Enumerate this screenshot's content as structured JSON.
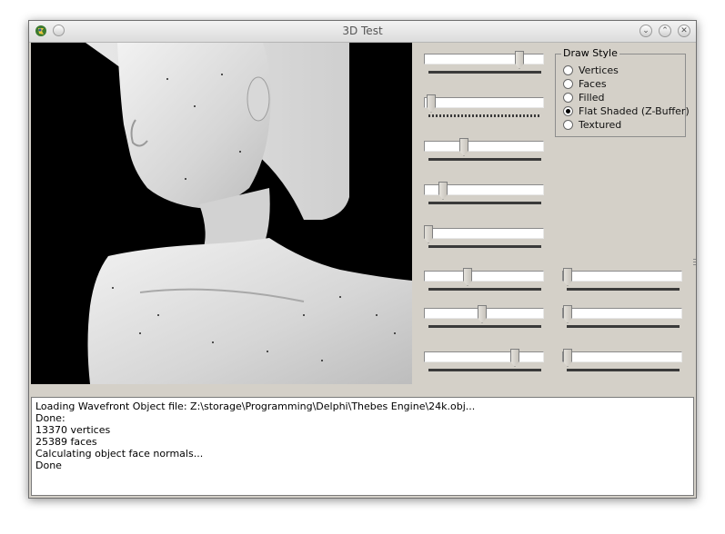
{
  "window": {
    "title": "3D Test"
  },
  "draw_style": {
    "legend": "Draw Style",
    "options": [
      {
        "label": "Vertices",
        "checked": false
      },
      {
        "label": "Faces",
        "checked": false
      },
      {
        "label": "Filled",
        "checked": false
      },
      {
        "label": "Flat Shaded (Z-Buffer)",
        "checked": true
      },
      {
        "label": "Textured",
        "checked": false
      }
    ]
  },
  "sliders": {
    "s1": {
      "value": 0.81
    },
    "s2": {
      "value": 0.03
    },
    "s3": {
      "value": 0.32
    },
    "s4": {
      "value": 0.15
    },
    "s5": {
      "value": 0.0
    },
    "s6": {
      "value": 0.37
    },
    "s7": {
      "value": 0.5
    },
    "s8": {
      "value": 0.76
    },
    "s9": {
      "value": 0.0
    },
    "s10": {
      "value": 0.0
    },
    "s11": {
      "value": 0.0
    }
  },
  "log": {
    "lines": [
      "Loading Wavefront Object file: Z:\\storage\\Programming\\Delphi\\Thebes Engine\\24k.obj...",
      "Done:",
      "13370 vertices",
      "25389 faces",
      "Calculating object face normals...",
      "Done"
    ]
  }
}
